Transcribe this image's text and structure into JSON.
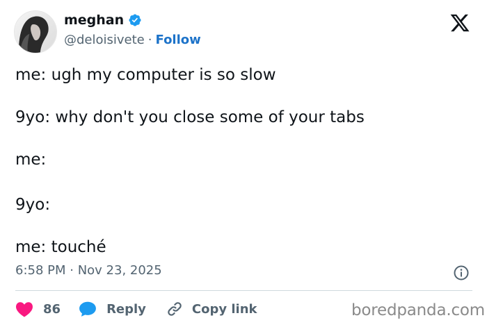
{
  "author": {
    "display_name": "meghan",
    "handle": "@deloisivete",
    "separator": "·",
    "follow_label": "Follow"
  },
  "tweet": {
    "lines": [
      "me: ugh my computer is so slow",
      "9yo: why don't you close some of your tabs",
      "me:",
      "9yo:",
      "me: touché"
    ],
    "timestamp": "6:58 PM · Nov 23, 2025"
  },
  "actions": {
    "like_count": "86",
    "reply_label": "Reply",
    "copy_link_label": "Copy link"
  },
  "watermark": "boredpanda.com",
  "icons": {
    "verified": "verified-badge-icon",
    "x_logo": "x-logo-icon",
    "info": "info-icon",
    "like": "heart-icon",
    "reply": "speech-bubble-icon",
    "copy": "link-icon"
  },
  "colors": {
    "verified_blue": "#1d9bf0",
    "follow_blue": "#1d73c9",
    "like_pink": "#f91880",
    "reply_blue": "#1d9bf0",
    "text_primary": "#0f1419",
    "text_secondary": "#536471"
  }
}
